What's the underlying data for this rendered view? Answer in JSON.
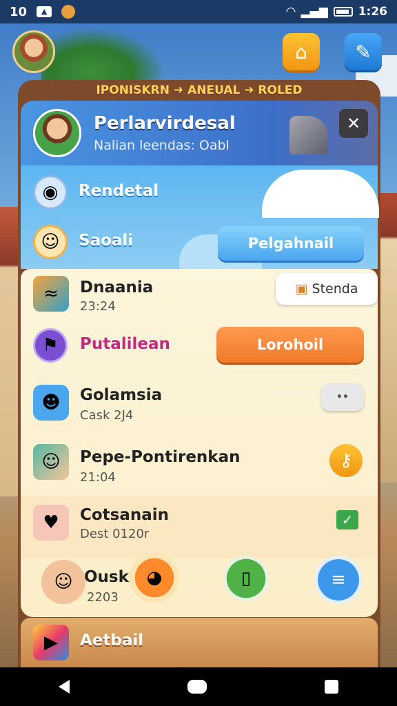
{
  "status_bar": {
    "left_text": "10",
    "time": "1:26"
  },
  "panel": {
    "title": "IPONISKRN ➜ ANEUAL ➜ ROLED"
  },
  "profile": {
    "name": "Perlarvirdesal",
    "subtitle": "Nalian leendas: Oabl"
  },
  "rows": {
    "rendetal": {
      "label": "Rendetal"
    },
    "saoali": {
      "label": "Saoali",
      "button": "Pelgahnail"
    },
    "dnaania": {
      "label": "Dnaania",
      "time": "23:24",
      "button": "Stenda"
    },
    "putalilean": {
      "label": "Putalilean",
      "button": "Lorohoil"
    },
    "golamsia": {
      "label": "Golamsia",
      "sub": "Cask 2J4",
      "button": "••"
    },
    "pepe": {
      "label": "Pepe-Pontirenkan",
      "time": "21:04"
    },
    "cotsanain": {
      "label": "Cotsanain",
      "sub": "Dest 0120r"
    },
    "ousk": {
      "label": "Ousk",
      "sub": "2203"
    },
    "aetbail": {
      "label": "Aetbail"
    }
  },
  "colors": {
    "accent_orange": "#f07a2a",
    "accent_blue": "#4aa6ef",
    "label_pink": "#c02a82"
  }
}
